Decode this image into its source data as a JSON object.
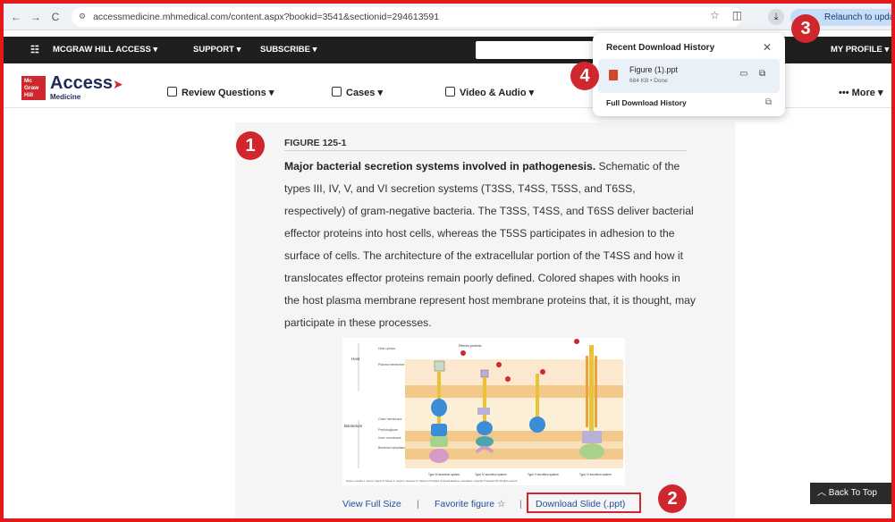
{
  "browser": {
    "back": "←",
    "forward": "→",
    "reload": "C",
    "url": "accessmedicine.mhmedical.com/content.aspx?bookid=3541&sectionid=294613591",
    "relaunch": "Relaunch to update"
  },
  "top_nav": {
    "brand": "MCGRAW HILL ACCESS",
    "support": "SUPPORT",
    "subscribe": "SUBSCRIBE",
    "profile": "MY PROFILE"
  },
  "header": {
    "logo_box": "Mc\nGraw\nHill",
    "logo_text": "Access",
    "logo_sub": "Medicine",
    "menu": {
      "review": "Review Questions",
      "cases": "Cases",
      "video": "Video & Audio",
      "more": "More"
    }
  },
  "figure": {
    "label": "FIGURE 125-1",
    "caption_bold": "Major bacterial secretion systems involved in pathogenesis.",
    "caption_rest": " Schematic of the types III, IV, V, and VI secretion systems (T3SS, T4SS, T5SS, and T6SS, respectively) of gram-negative bacteria. The T3SS, T4SS, and T6SS deliver bacterial effector proteins into host cells, whereas the T5SS participates in adhesion to the surface of cells. The architecture of the extracellular portion of the T4SS and how it translocates effector proteins remain poorly defined. Colored shapes with hooks in the host plasma membrane represent host membrane proteins that, it is thought, may participate in these processes.",
    "diagram": {
      "effector": "Effector proteins",
      "host": "Host",
      "host_cytosol": "Host cytosol",
      "plasma_membrane": "Plasma membrane",
      "bacterium": "Bacterium",
      "outer_membrane": "Outer membrane",
      "peptidoglycan": "Peptidoglycan",
      "inner_membrane": "Inner membrane",
      "bacterial_cytoplasm": "Bacterial cytoplasm",
      "type3": "Type III secretion system",
      "type4": "Type IV secretion system",
      "type5": "Type V secretion system",
      "type6": "Type VI secretion system",
      "source": "Source: Loscalzo J, Fauci A, Kasper D, Hauser S, Longo D, Jameson JL. Harrison's Principles of Internal Medicine, 21st Edition. Copyright © McGraw Hill. All rights reserved."
    },
    "links": {
      "full_size": "View Full Size",
      "favorite": "Favorite figure ☆",
      "download_slide": "Download Slide (.ppt)"
    }
  },
  "download_popup": {
    "title": "Recent Download History",
    "close": "✕",
    "file_name": "Figure (1).ppt",
    "file_status": "684 KB • Done",
    "full_history": "Full Download History"
  },
  "callouts": [
    "1",
    "2",
    "3",
    "4"
  ],
  "back_to_top": "Back To Top",
  "colors": {
    "accent_red": "#d0262d",
    "link_blue": "#1f4e9c",
    "nav_black": "#1f1f1f"
  }
}
